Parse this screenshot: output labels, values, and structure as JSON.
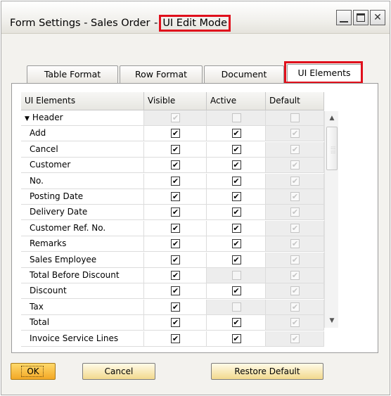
{
  "window": {
    "title_prefix": "Form Settings - Sales Order",
    "title_sep": "-",
    "title_mode": "UI Edit Mode",
    "buttons": [
      "minimize-icon",
      "maximize-icon",
      "close-icon"
    ]
  },
  "tabs": [
    {
      "label": "Table Format",
      "active": false
    },
    {
      "label": "Row Format",
      "active": false
    },
    {
      "label": "Document",
      "active": false
    },
    {
      "label": "UI Elements",
      "active": true
    }
  ],
  "grid": {
    "columns": [
      "UI Elements",
      "Visible",
      "Active",
      "Default"
    ],
    "rows": [
      {
        "name": "Header",
        "group": true,
        "visible": "dis",
        "active": "empty-dis",
        "default": "empty-dis"
      },
      {
        "name": "Add",
        "visible": "on",
        "active": "on",
        "default": "dis"
      },
      {
        "name": "Cancel",
        "visible": "on",
        "active": "on",
        "default": "dis"
      },
      {
        "name": "Customer",
        "visible": "on",
        "active": "on",
        "default": "dis"
      },
      {
        "name": "No.",
        "visible": "on",
        "active": "on",
        "default": "dis"
      },
      {
        "name": "Posting Date",
        "visible": "on",
        "active": "on",
        "default": "dis"
      },
      {
        "name": "Delivery Date",
        "visible": "on",
        "active": "on",
        "default": "dis"
      },
      {
        "name": "Customer Ref. No.",
        "visible": "on",
        "active": "on",
        "default": "dis"
      },
      {
        "name": "Remarks",
        "visible": "on",
        "active": "on",
        "default": "dis"
      },
      {
        "name": "Sales Employee",
        "visible": "on",
        "active": "on",
        "default": "dis"
      },
      {
        "name": "Total Before Discount",
        "visible": "on",
        "active": "empty-dis",
        "default": "dis"
      },
      {
        "name": "Discount",
        "visible": "on",
        "active": "on",
        "default": "dis"
      },
      {
        "name": "Tax",
        "visible": "on",
        "active": "empty-dis",
        "default": "dis"
      },
      {
        "name": "Total",
        "visible": "on",
        "active": "on",
        "default": "dis"
      },
      {
        "name": "Invoice Service Lines",
        "visible": "on",
        "active": "on",
        "default": "dis"
      }
    ]
  },
  "scrollbar": {
    "up": "▲",
    "down": "▼"
  },
  "actions": {
    "ok": "OK",
    "cancel": "Cancel",
    "restore": "Restore Default"
  },
  "colors": {
    "highlight": "#e0101c",
    "ok_button": "#f3a825"
  }
}
